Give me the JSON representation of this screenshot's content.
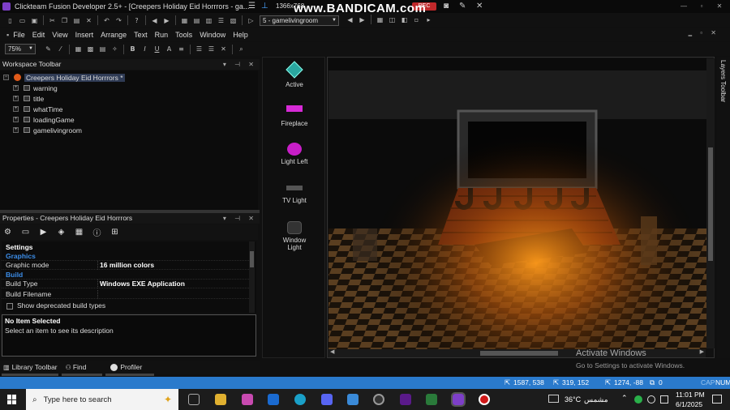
{
  "window": {
    "title": "Clickteam Fusion Developer 2.5+ - [Creepers Holiday Eid Horrrors - ga...",
    "resolution": "1366x768",
    "frame_combo": "5 - gamelivingroom",
    "rec": "REC"
  },
  "watermark_overlay": "www.BANDICAM.com",
  "menu": [
    "File",
    "Edit",
    "View",
    "Insert",
    "Arrange",
    "Text",
    "Run",
    "Tools",
    "Window",
    "Help"
  ],
  "zoom": "75%",
  "workspace": {
    "title": "Workspace Toolbar",
    "root": "Creepers Holiday Eid Horrrors *",
    "frames": [
      "warning",
      "title",
      "whatTime",
      "loadingGame",
      "gamelivingroom"
    ]
  },
  "properties": {
    "title": "Properties - Creepers Holiday Eid Horrrors",
    "settings_label": "Settings",
    "cat_graphics": "Graphics",
    "graphic_mode_key": "Graphic mode",
    "graphic_mode_val": "16 million colors",
    "cat_build": "Build",
    "build_type_key": "Build Type",
    "build_type_val": "Windows EXE Application",
    "build_filename_key": "Build Filename",
    "deprecated": "Show deprecated build types",
    "desc_title": "No Item Selected",
    "desc_text": "Select an item to see its description"
  },
  "bottom_tabs": {
    "library": "Library Toolbar",
    "find": "Find",
    "profiler": "Profiler"
  },
  "objects": [
    {
      "label": "Active",
      "color": "#2aa7a0",
      "icon": "diamond-icon"
    },
    {
      "label": "Fireplace",
      "color": "#d62ad6",
      "icon": "fireplace-icon"
    },
    {
      "label": "Light Left",
      "color": "#c81ec8",
      "icon": "light-icon"
    },
    {
      "label": "TV Light",
      "color": "#555555",
      "icon": "tv-light-icon"
    },
    {
      "label": "Window Light",
      "color": "#444444",
      "icon": "window-light-icon"
    }
  ],
  "layers_toolbar": "Layers Toolbar",
  "activate": {
    "title": "Activate Windows",
    "subtitle": "Go to Settings to activate Windows."
  },
  "status": {
    "pos1": "1587, 538",
    "pos2": "319, 152",
    "pos3": "1274, -88",
    "count": "0",
    "caps": "CAP",
    "num": "NUM"
  },
  "taskbar": {
    "search": "Type here to search",
    "temp": "36°C",
    "weather": "مشمس",
    "time": "11:01 PM",
    "date": "6/1/2025"
  }
}
